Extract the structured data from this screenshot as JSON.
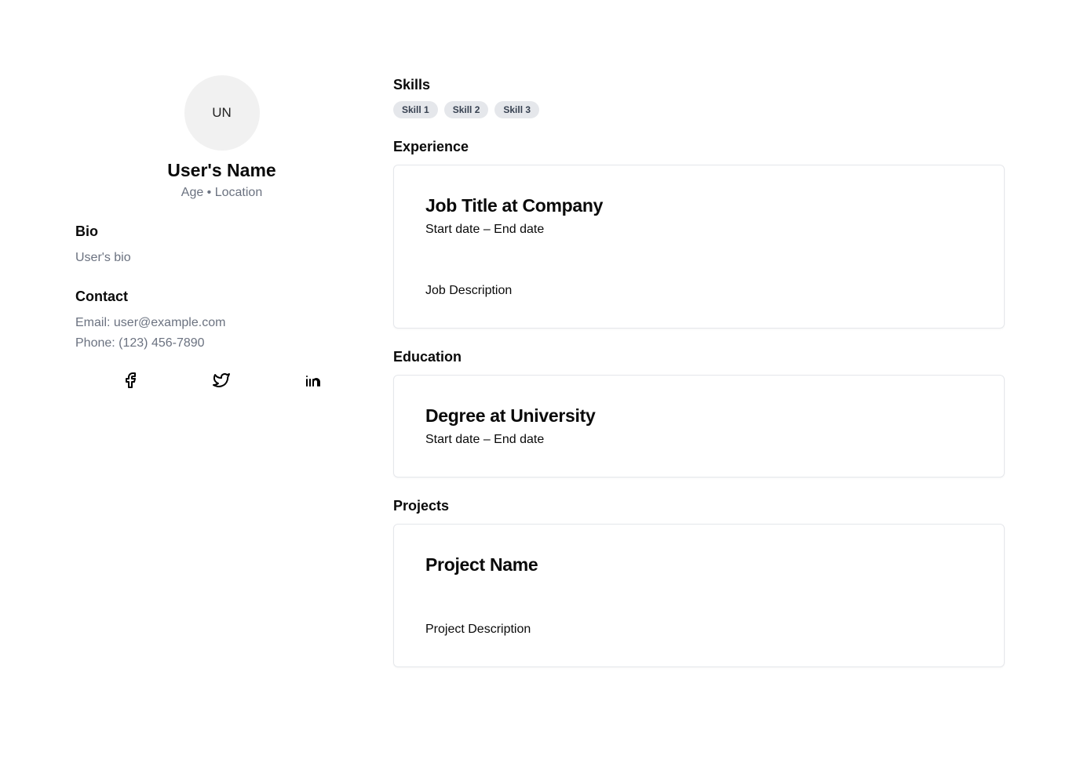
{
  "profile": {
    "initials": "UN",
    "name": "User's Name",
    "meta": "Age • Location"
  },
  "bio": {
    "heading": "Bio",
    "text": "User's bio"
  },
  "contact": {
    "heading": "Contact",
    "email": "Email: user@example.com",
    "phone": "Phone: (123) 456-7890"
  },
  "social": [
    "facebook-icon",
    "twitter-icon",
    "linkedin-icon"
  ],
  "skills": {
    "heading": "Skills",
    "items": [
      "Skill 1",
      "Skill 2",
      "Skill 3"
    ]
  },
  "experience": {
    "heading": "Experience",
    "title": "Job Title at Company",
    "dates": "Start date – End date",
    "description": "Job Description"
  },
  "education": {
    "heading": "Education",
    "title": "Degree at University",
    "dates": "Start date – End date"
  },
  "projects": {
    "heading": "Projects",
    "title": "Project Name",
    "description": "Project Description"
  }
}
